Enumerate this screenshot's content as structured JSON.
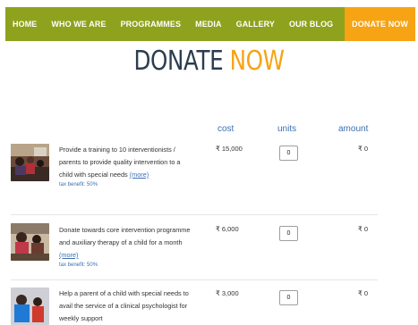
{
  "nav": {
    "items": [
      "HOME",
      "WHO WE ARE",
      "PROGRAMMES",
      "MEDIA",
      "GALLERY",
      "OUR BLOG"
    ],
    "active": "DONATE NOW"
  },
  "title": {
    "part1": "DONATE",
    "part2": "NOW"
  },
  "table": {
    "headers": {
      "cost": "cost",
      "units": "units",
      "amount": "amount"
    },
    "rows": [
      {
        "description": "Provide a training to 10 interventionists / parents to provide quality intervention to a child with special needs",
        "more": "(more)",
        "tax": "tax benefit: 50%",
        "cost": "₹ 15,000",
        "units": "0",
        "amount": "₹ 0"
      },
      {
        "description": "Donate towards core intervention programme and auxiliary therapy of a child for a month",
        "more": "(more)",
        "tax": "tax benefit: 50%",
        "cost": "₹ 6,000",
        "units": "0",
        "amount": "₹ 0"
      },
      {
        "description": "Help a parent of a child with special needs to avail the service of a clinical psychologist for weekly support",
        "more": "",
        "tax": "",
        "cost": "₹ 3,000",
        "units": "0",
        "amount": "₹ 0"
      }
    ]
  }
}
